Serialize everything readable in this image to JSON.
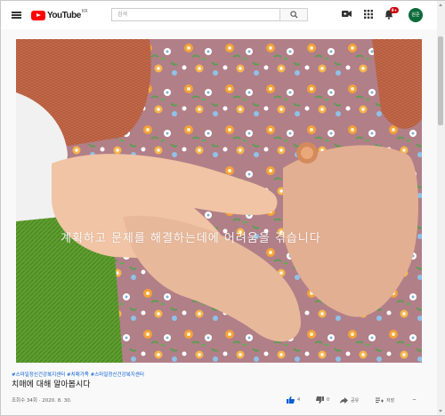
{
  "header": {
    "logo_text": "YouTube",
    "logo_region": "KR",
    "search_placeholder": "검색"
  },
  "notifications": {
    "count": "9+"
  },
  "account": {
    "avatar_text": "원준"
  },
  "video": {
    "overlay_caption": "계획하고 문제를 해결하는데에 어려움을 겪습니다"
  },
  "info": {
    "hashtags": "#스마일정신건강복지센터  #치매가족  #스마일정신건강복지센터",
    "title": "치매에 대해 알아봅시다",
    "views_date": "조회수 34회 · 2020. 8. 30.",
    "likes": "4",
    "dislikes": "0",
    "share": "공유",
    "save": "저장",
    "more": "···"
  },
  "colors": {
    "accent": "#065fd4",
    "brand_red": "#ff0000",
    "avatar_bg": "#0c6b3a"
  }
}
